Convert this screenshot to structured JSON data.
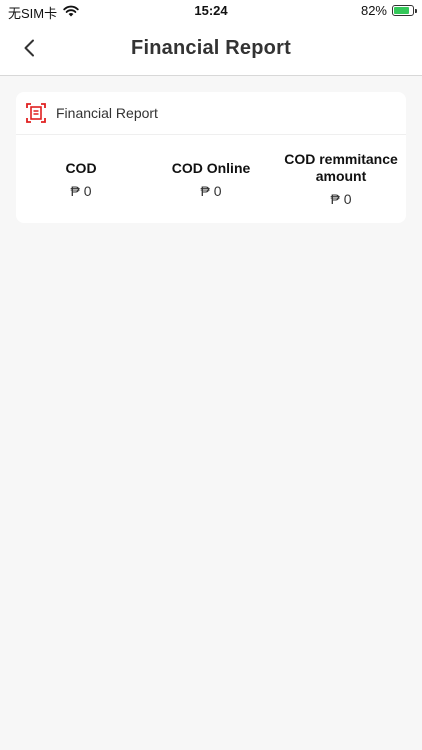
{
  "status_bar": {
    "carrier": "无SIM卡",
    "time": "15:24",
    "battery_percent": "82%",
    "battery_level": 0.82
  },
  "nav": {
    "title": "Financial Report",
    "back_icon": "chevron-left-icon"
  },
  "card": {
    "icon": "receipt-scan-icon",
    "title": "Financial Report",
    "stats": [
      {
        "label": "COD",
        "value": "₱ 0"
      },
      {
        "label": "COD Online",
        "value": "₱ 0"
      },
      {
        "label": "COD remmitance amount",
        "value": "₱ 0"
      }
    ]
  },
  "colors": {
    "accent": "#e02020",
    "battery": "#34c759"
  }
}
